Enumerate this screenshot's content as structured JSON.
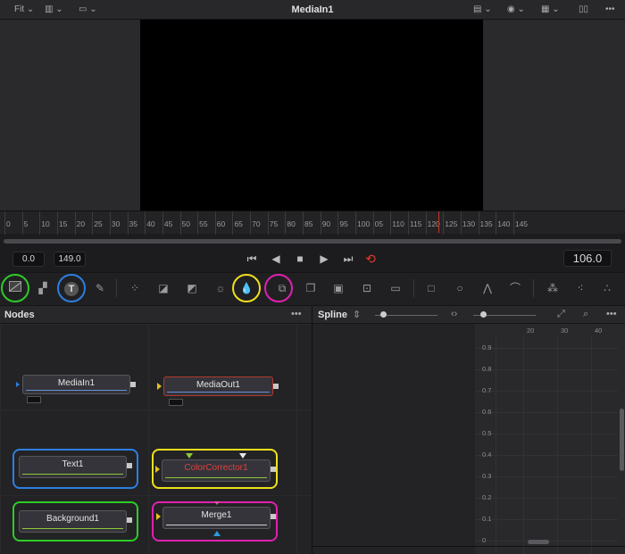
{
  "viewer": {
    "fit_label": "Fit",
    "title": "MediaIn1"
  },
  "ruler": {
    "ticks": [
      "0",
      "5",
      "10",
      "15",
      "20",
      "25",
      "30",
      "35",
      "40",
      "45",
      "50",
      "55",
      "60",
      "65",
      "70",
      "75",
      "80",
      "85",
      "90",
      "95",
      "100",
      "05",
      "110",
      "115",
      "120",
      "125",
      "130",
      "135",
      "140",
      "145"
    ]
  },
  "transport": {
    "range_start": "0.0",
    "range_end": "149.0",
    "current_frame": "106.0"
  },
  "nodes": {
    "title": "Nodes",
    "menu": "•••",
    "items": [
      {
        "label": "MediaIn1"
      },
      {
        "label": "MediaOut1"
      },
      {
        "label": "Text1"
      },
      {
        "label": "ColorCorrector1"
      },
      {
        "label": "Background1"
      },
      {
        "label": "Merge1"
      }
    ]
  },
  "spline": {
    "title": "Spline",
    "menu": "•••",
    "y_labels": [
      "0.9",
      "0.8",
      "0.7",
      "0.6",
      "0.5",
      "0.4",
      "0.3",
      "0.2",
      "0.1",
      "0"
    ],
    "x_labels": [
      "20",
      "30",
      "40"
    ]
  },
  "colors": {
    "highlight_green": "#2ecc27",
    "highlight_blue": "#2d7fe0",
    "highlight_yellow": "#f0e01c",
    "highlight_magenta": "#e020b0",
    "playhead": "#c0392b",
    "node_selected_border": "#b23a2e",
    "color_corrector_text": "#e04040"
  }
}
